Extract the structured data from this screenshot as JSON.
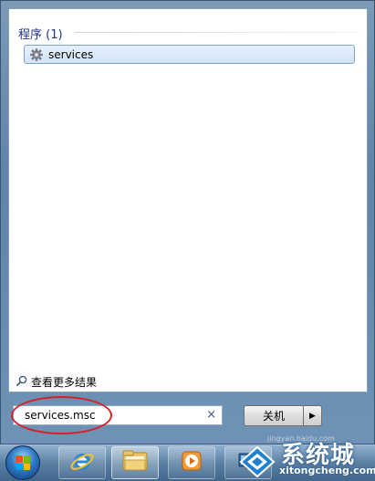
{
  "results": {
    "section_title": "程序 (1)",
    "items": [
      {
        "label": "services",
        "icon": "gear-icon"
      }
    ],
    "see_more_label": "查看更多结果"
  },
  "search": {
    "value": "services.msc",
    "clear_glyph": "×"
  },
  "power": {
    "shutdown_label": "关机",
    "arrow_glyph": "▶"
  },
  "taskbar": {
    "buttons": [
      {
        "name": "internet-explorer",
        "icon": "ie-icon"
      },
      {
        "name": "windows-explorer",
        "icon": "folder-icon"
      },
      {
        "name": "media-player",
        "icon": "media-player-icon"
      },
      {
        "name": "remote-desktop",
        "icon": "monitor-icon"
      }
    ]
  },
  "watermark": {
    "brand": "系统城",
    "domain": "xitongcheng.com",
    "faint_text": "jingyan.baidu.com"
  },
  "colors": {
    "accent_red": "#d3232a",
    "header_blue": "#1e3287",
    "selection_border": "#7da2ce"
  }
}
